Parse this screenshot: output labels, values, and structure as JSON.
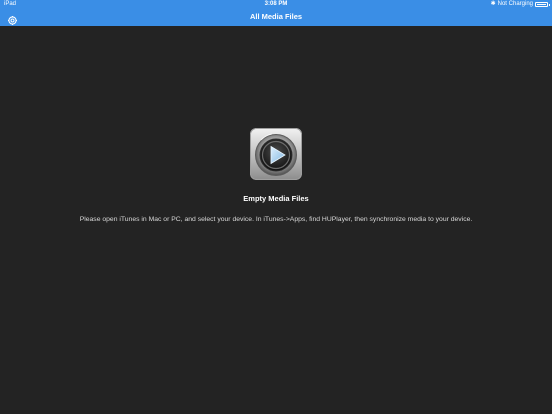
{
  "status_bar": {
    "device": "iPad",
    "time": "3:08 PM",
    "charging": "Not Charging",
    "battery_level": 0.95
  },
  "nav_bar": {
    "title": "All Media Files",
    "settings_icon": "gear-icon"
  },
  "empty_state": {
    "icon": "play-button-icon",
    "title": "Empty Media Files",
    "message": "Please open iTunes in Mac or PC, and select your device. In iTunes->Apps, find HUPlayer, then synchronize media to your device."
  },
  "colors": {
    "nav_bar": "#3a8ee6",
    "background": "#232323",
    "text_primary": "#ffffff",
    "text_secondary": "#d8d8d8"
  }
}
